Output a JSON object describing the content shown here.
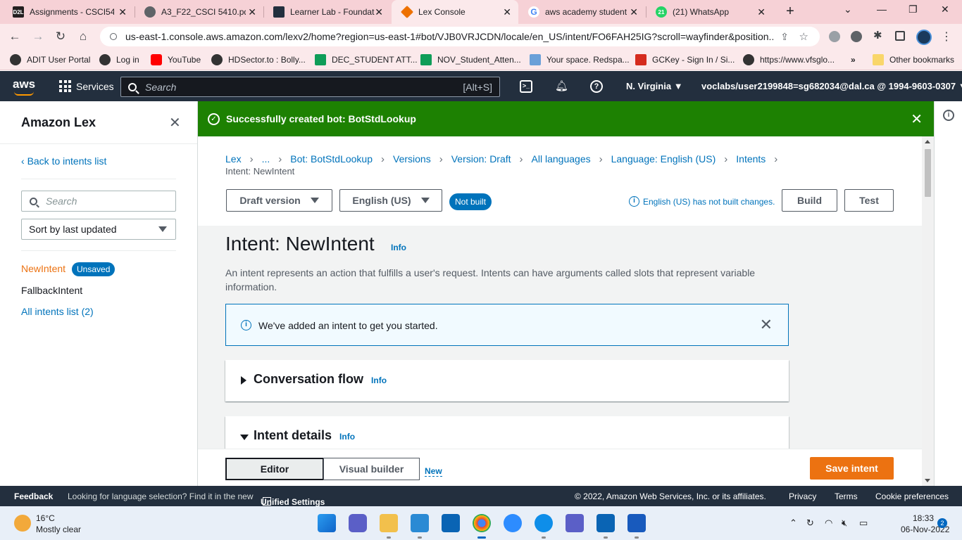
{
  "browser": {
    "tabs": [
      {
        "title": "Assignments - CSCI54",
        "favicon": "d2l-icon",
        "fav_text": "D2L"
      },
      {
        "title": "A3_F22_CSCI 5410.pdf",
        "favicon": "globe-icon",
        "fav_text": ""
      },
      {
        "title": "Learner Lab - Foundat",
        "favicon": "aws-academy-icon",
        "fav_text": ""
      },
      {
        "title": "Lex Console",
        "favicon": "aws-cube-icon",
        "fav_text": ""
      },
      {
        "title": "aws academy student",
        "favicon": "google-icon",
        "fav_text": "G"
      },
      {
        "title": "(21) WhatsApp",
        "favicon": "whatsapp-icon",
        "fav_text": "21"
      }
    ],
    "url": "us-east-1.console.aws.amazon.com/lexv2/home?region=us-east-1#bot/VJB0VRJCDN/locale/en_US/intent/FO6FAH25IG?scroll=wayfinder&position...",
    "bookmarks": [
      {
        "label": "ADIT User Portal"
      },
      {
        "label": "Log in"
      },
      {
        "label": "YouTube"
      },
      {
        "label": "HDSector.to : Bolly..."
      },
      {
        "label": "DEC_STUDENT ATT..."
      },
      {
        "label": "NOV_Student_Atten..."
      },
      {
        "label": "Your space. Redspa..."
      },
      {
        "label": "GCKey - Sign In / Si..."
      },
      {
        "label": "https://www.vfsglo..."
      }
    ],
    "more_bookmarks": "»",
    "other_bookmarks": "Other bookmarks"
  },
  "aws_header": {
    "logo": "aws",
    "services": "Services",
    "search_placeholder": "Search",
    "search_shortcut": "[Alt+S]",
    "region": "N. Virginia",
    "account": "voclabs/user2199848=sg682034@dal.ca @ 1994-9603-0307"
  },
  "sidenav": {
    "title": "Amazon Lex",
    "back_link": "Back to intents list",
    "search_placeholder": "Search",
    "sort_label": "Sort by last updated",
    "intents": [
      {
        "name": "NewIntent",
        "badge": "Unsaved"
      },
      {
        "name": "FallbackIntent"
      }
    ],
    "all_intents": "All intents list (2)"
  },
  "flash": {
    "message": "Successfully created bot: BotStdLookup",
    "color": "#1d8102"
  },
  "breadcrumbs": [
    "Lex",
    "...",
    "Bot: BotStdLookup",
    "Versions",
    "Version: Draft",
    "All languages",
    "Language: English (US)",
    "Intents"
  ],
  "breadcrumb_current": "Intent: NewIntent",
  "controls": {
    "version": "Draft version",
    "language": "English (US)",
    "status_badge": "Not built",
    "build_note": "English (US) has not built changes.",
    "build": "Build",
    "test": "Test"
  },
  "intent": {
    "title": "Intent: NewIntent",
    "info": "Info",
    "description": "An intent represents an action that fulfills a user's request. Intents can have arguments called slots that represent variable information.",
    "alert": "We've added an intent to get you started."
  },
  "panels": [
    {
      "title": "Conversation flow",
      "info": "Info",
      "expanded": false
    },
    {
      "title": "Intent details",
      "info": "Info",
      "expanded": true
    }
  ],
  "bottom_bar": {
    "editor": "Editor",
    "visual_builder": "Visual builder",
    "new": "New",
    "save": "Save intent",
    "accent": "#ec7211"
  },
  "footer": {
    "feedback": "Feedback",
    "lang_note": "Looking for language selection? Find it in the new",
    "unified": "Unified Settings",
    "copyright": "© 2022, Amazon Web Services, Inc. or its affiliates.",
    "privacy": "Privacy",
    "terms": "Terms",
    "cookies": "Cookie preferences"
  },
  "taskbar": {
    "temp": "16°C",
    "weather": "Mostly clear",
    "time": "18:33",
    "date": "06-Nov-2022",
    "notifications": "2"
  }
}
